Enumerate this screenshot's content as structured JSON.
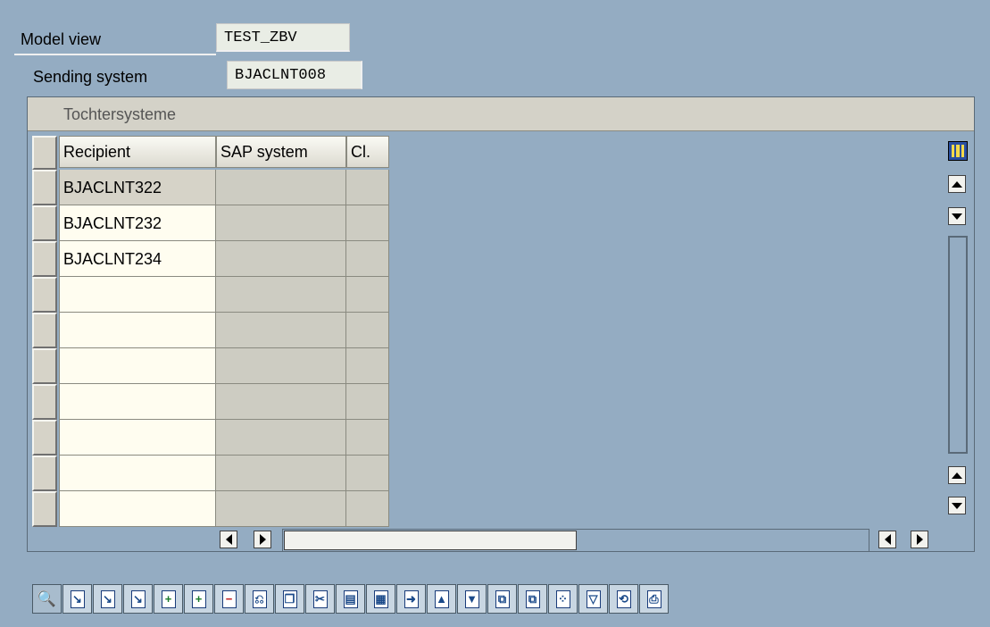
{
  "header": {
    "model_view_label": "Model view",
    "model_view_value": "TEST_ZBV",
    "sending_system_label": "Sending system",
    "sending_system_value": "BJACLNT008"
  },
  "panel": {
    "title": "Tochtersysteme"
  },
  "table": {
    "columns": [
      "Recipient",
      "SAP system",
      "Cl."
    ],
    "rows": [
      [
        "BJACLNT322",
        "",
        ""
      ],
      [
        "BJACLNT232",
        "",
        ""
      ],
      [
        "BJACLNT234",
        "",
        ""
      ],
      [
        "",
        "",
        ""
      ],
      [
        "",
        "",
        ""
      ],
      [
        "",
        "",
        ""
      ],
      [
        "",
        "",
        ""
      ],
      [
        "",
        "",
        ""
      ],
      [
        "",
        "",
        ""
      ],
      [
        "",
        "",
        ""
      ]
    ]
  },
  "toolbar": {
    "buttons": [
      {
        "name": "details-icon",
        "glyph": "🔍",
        "enabled": false
      },
      {
        "name": "insert-row-icon",
        "glyph": "↘",
        "enabled": true
      },
      {
        "name": "append-row-icon",
        "glyph": "↘",
        "enabled": true
      },
      {
        "name": "copy-row-icon",
        "glyph": "↘",
        "enabled": true
      },
      {
        "name": "add-entry-icon",
        "glyph": "+",
        "enabled": true
      },
      {
        "name": "insert-entry-icon",
        "glyph": "+",
        "enabled": true
      },
      {
        "name": "delete-row-icon",
        "glyph": "−",
        "enabled": true
      },
      {
        "name": "undo-icon",
        "glyph": "⎌",
        "enabled": true
      },
      {
        "name": "copy-icon",
        "glyph": "❐",
        "enabled": true
      },
      {
        "name": "cut-icon",
        "glyph": "✂",
        "enabled": true
      },
      {
        "name": "copy-text-icon",
        "glyph": "▤",
        "enabled": true
      },
      {
        "name": "paste-icon",
        "glyph": "▦",
        "enabled": true
      },
      {
        "name": "paste-new-rows-icon",
        "glyph": "➜",
        "enabled": true
      },
      {
        "name": "sort-ascending-icon",
        "glyph": "▲",
        "enabled": true
      },
      {
        "name": "sort-descending-icon",
        "glyph": "▼",
        "enabled": true
      },
      {
        "name": "find-icon",
        "glyph": "⧉",
        "enabled": true
      },
      {
        "name": "find-next-icon",
        "glyph": "⧉",
        "enabled": true
      },
      {
        "name": "select-layout-icon",
        "glyph": "⁘",
        "enabled": true
      },
      {
        "name": "filter-icon",
        "glyph": "▽",
        "enabled": true
      },
      {
        "name": "refresh-icon",
        "glyph": "⟲",
        "enabled": true
      },
      {
        "name": "print-icon",
        "glyph": "⎙",
        "enabled": true
      }
    ]
  },
  "colors": {
    "background": "#94acc2",
    "input_field": "#e9ede5",
    "grid_editable": "#fffdf0",
    "grid_readonly": "#cdccc2"
  }
}
